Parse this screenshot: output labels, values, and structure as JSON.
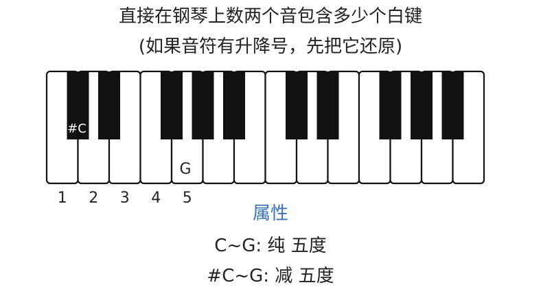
{
  "header": {
    "line1": "直接在钢琴上数两个音包含多少个白键",
    "line2": "(如果音符有升降号，先把它还原)"
  },
  "keyboard": {
    "white_key_count": 14,
    "black_keys_after_white": [
      1,
      2,
      4,
      5,
      6,
      8,
      9,
      11,
      12,
      13
    ],
    "labels": {
      "sharp_c": "#C",
      "g": "G"
    },
    "numbers": [
      "1",
      "2",
      "3",
      "4",
      "5"
    ]
  },
  "properties": {
    "title": "属性",
    "line1": "C~G: 纯 五度",
    "line2": "#C~G: 减 五度"
  },
  "colors": {
    "accent": "#3a73b5",
    "text": "#222222",
    "black_key": "#111111",
    "white_key": "#ffffff"
  }
}
